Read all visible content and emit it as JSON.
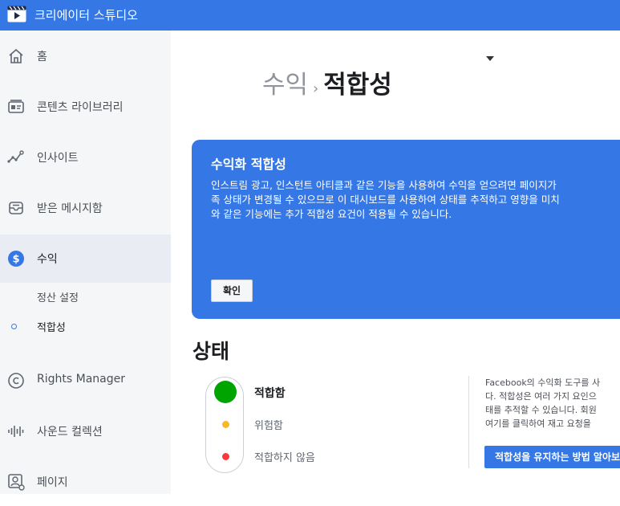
{
  "app": {
    "title": "크리에이터 스튜디오"
  },
  "sidebar": {
    "items": [
      {
        "label": "홈",
        "icon": "home-icon"
      },
      {
        "label": "콘텐츠 라이브러리",
        "icon": "content-library-icon"
      },
      {
        "label": "인사이트",
        "icon": "insights-icon"
      },
      {
        "label": "받은 메시지함",
        "icon": "inbox-icon"
      },
      {
        "label": "수익",
        "icon": "dollar-icon",
        "active": true
      },
      {
        "label": "Rights Manager",
        "icon": "copyright-icon"
      },
      {
        "label": "사운드 컬렉션",
        "icon": "sound-wave-icon"
      },
      {
        "label": "페이지",
        "icon": "page-settings-icon"
      }
    ],
    "subitems": [
      {
        "label": "정산 설정"
      },
      {
        "label": "적합성",
        "current": true
      }
    ]
  },
  "breadcrumb": {
    "parent": "수익",
    "separator": "›",
    "current": "적합성"
  },
  "banner": {
    "title": "수익화 적합성",
    "body": "인스트림 광고, 인스턴트 아티클과 같은 기능을 사용하여 수익을 얻으려면 페이지가\n족 상태가 변경될 수 있으므로 이 대시보드를 사용하여 상태를 추적하고 영향을 미치\n와 같은 기능에는 추가 적합성 요건이 적용될 수 있습니다.",
    "confirm_label": "확인"
  },
  "status": {
    "heading": "상태",
    "levels": [
      {
        "label": "적합함",
        "color": "#00a400",
        "selected": true
      },
      {
        "label": "위험함",
        "color": "#f7b928"
      },
      {
        "label": "적합하지 않음",
        "color": "#fa383e"
      }
    ],
    "description": "Facebook의 수익화 도구를 사\n다. 적합성은 여러 가지 요인으\n태를 추적할 수 있습니다. 회원\n여기를 클릭하여 재고 요청을 ",
    "learn_button": "적합성을 유지하는 방법 알아보"
  },
  "colors": {
    "accent": "#3578e5",
    "sidebar_bg": "#f5f6f7"
  }
}
